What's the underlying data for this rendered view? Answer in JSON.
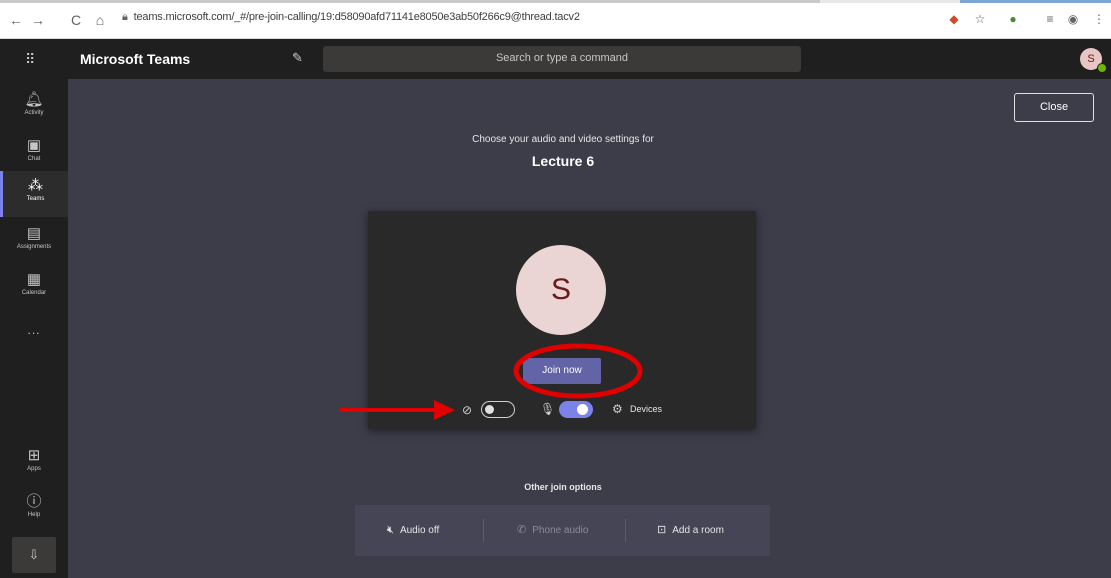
{
  "browser": {
    "url": "teams.microsoft.com/_#/pre-join-calling/19:d58090afd71141e8050e3ab50f266c9@thread.tacv2",
    "icons": [
      "back-icon",
      "forward-icon",
      "reload-icon",
      "home-icon",
      "lock-icon"
    ]
  },
  "header": {
    "app_title": "Microsoft Teams",
    "search_placeholder": "Search or type a command",
    "avatar_initial": "S"
  },
  "rail": {
    "items": [
      {
        "label": "Activity",
        "icon": "bell-icon"
      },
      {
        "label": "Chat",
        "icon": "chat-icon"
      },
      {
        "label": "Teams",
        "icon": "teams-icon"
      },
      {
        "label": "Assignments",
        "icon": "assignments-icon"
      },
      {
        "label": "Calendar",
        "icon": "calendar-icon"
      }
    ],
    "more": "...",
    "bottom": [
      {
        "label": "Apps",
        "icon": "apps-icon"
      },
      {
        "label": "Help",
        "icon": "help-icon"
      }
    ]
  },
  "prejoin": {
    "close_label": "Close",
    "choose_text": "Choose your audio and video settings for",
    "meeting_title": "Lecture 6",
    "avatar_initial": "S",
    "join_label": "Join now",
    "camera_on": false,
    "mic_on": true,
    "devices_label": "Devices"
  },
  "other_options": {
    "title": "Other join options",
    "audio_off": "Audio off",
    "phone_audio": "Phone audio",
    "add_room": "Add a room"
  },
  "colors": {
    "accent": "#6264a7",
    "annotation": "#e00000"
  }
}
